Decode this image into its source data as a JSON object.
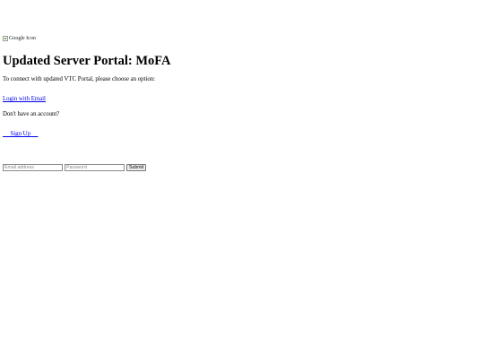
{
  "header": {
    "logo_alt": "Google Icon"
  },
  "page": {
    "title": "Updated Server Portal: MoFA",
    "intro": "To connect with updated VTC Portal, please choose an option:",
    "login_link": "Login with Email",
    "no_account_text": "Don't have an account?",
    "signup_link": "     Sign Up     "
  },
  "form": {
    "email_placeholder": "Email address",
    "password_placeholder": "Password",
    "submit_label": "Submit"
  },
  "colors": {
    "link": "#0000ee",
    "text": "#000000",
    "background": "#ffffff"
  }
}
